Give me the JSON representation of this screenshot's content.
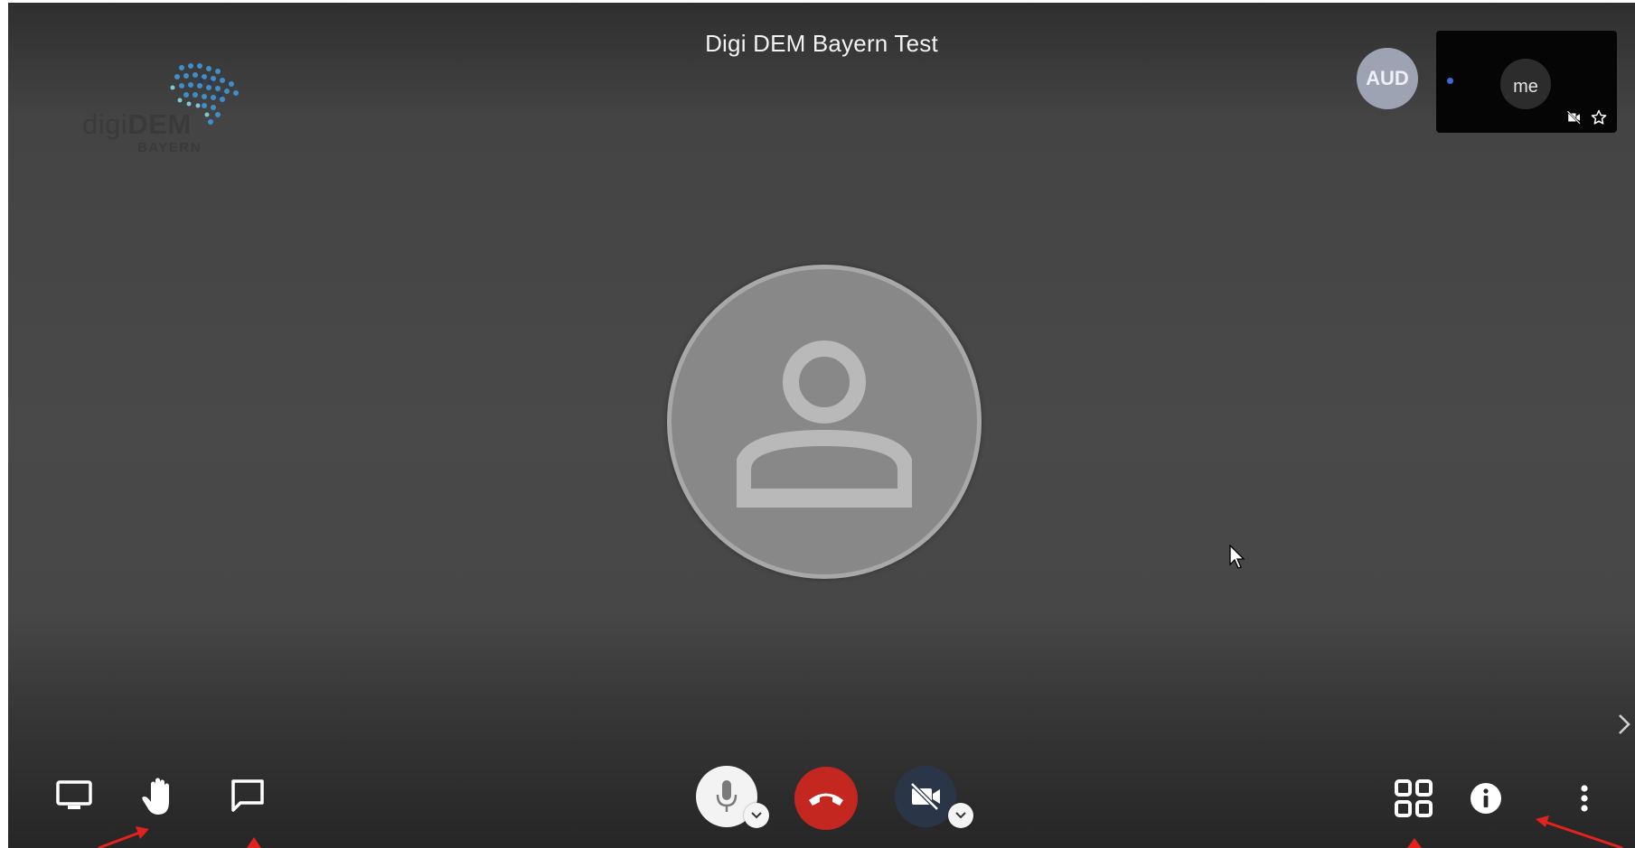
{
  "meeting": {
    "title": "Digi DEM Bayern Test"
  },
  "logo": {
    "word_light": "digi",
    "word_bold": "DEM",
    "sub": "BAYERN"
  },
  "participants": {
    "remote_initials": "AUD",
    "self_label": "me"
  },
  "toolbar": {
    "left": [
      "share-screen-icon",
      "raise-hand-icon",
      "chat-icon"
    ],
    "center": [
      "microphone-icon",
      "hangup-icon",
      "camera-off-icon"
    ],
    "right": [
      "tile-view-icon",
      "info-icon",
      "more-options-icon"
    ]
  },
  "colors": {
    "hangup": "#c4271f",
    "camera_button": "#2b3548",
    "annotation_arrow": "#e0231f",
    "remote_avatar": "#9ea3b4"
  }
}
